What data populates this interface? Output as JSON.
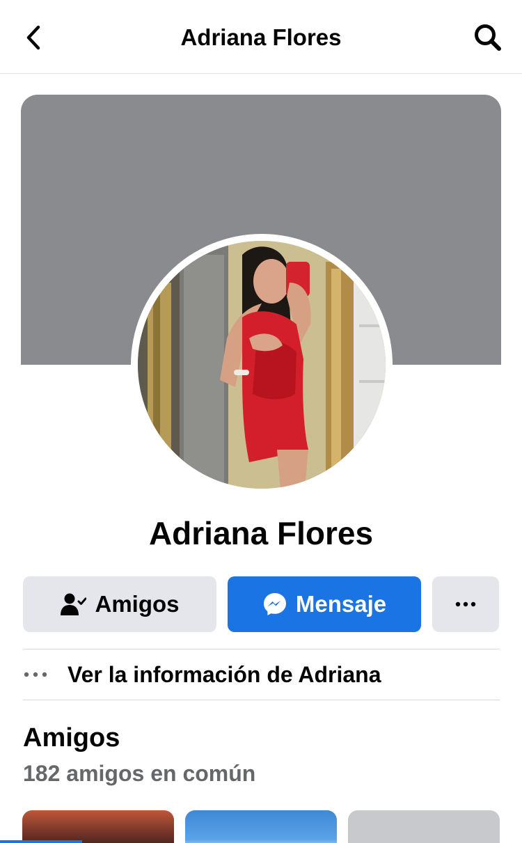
{
  "header": {
    "title": "Adriana Flores",
    "back_icon": "chevron-left-icon",
    "search_icon": "search-icon"
  },
  "profile": {
    "name": "Adriana Flores",
    "cover_color": "#8a8b8f"
  },
  "actions": {
    "friends_label": "Amigos",
    "message_label": "Mensaje",
    "more_icon": "ellipsis-icon",
    "accent": "#1b74e4"
  },
  "info": {
    "label": "Ver la información de Adriana"
  },
  "friends": {
    "title": "Amigos",
    "mutual": "182 amigos en común"
  }
}
